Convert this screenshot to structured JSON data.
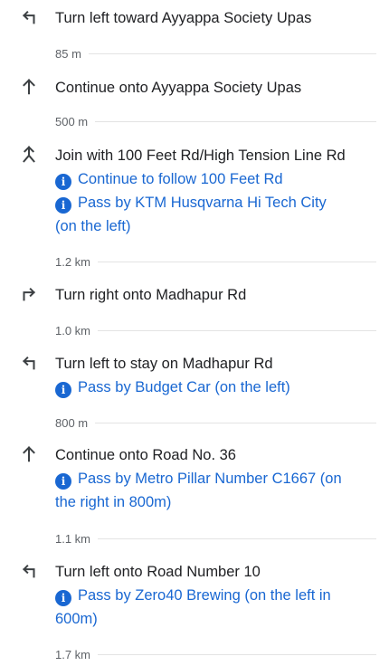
{
  "steps": [
    {
      "icon": "turn-left-icon",
      "instruction": "Turn left toward Ayyappa Society Upas",
      "notes": [],
      "distance": "85 m"
    },
    {
      "icon": "straight-arrow-icon",
      "instruction": "Continue onto Ayyappa Society Upas",
      "notes": [],
      "distance": "500 m"
    },
    {
      "icon": "merge-icon",
      "instruction": "Join with 100 Feet Rd/High Tension Line Rd",
      "notes": [
        {
          "text": "Continue to follow 100 Feet Rd"
        },
        {
          "line1": "Pass by KTM Husqvarna Hi Tech City",
          "line2": "(on the left)"
        }
      ],
      "distance": "1.2 km"
    },
    {
      "icon": "turn-right-icon",
      "instruction": "Turn right onto Madhapur Rd",
      "notes": [],
      "distance": "1.0 km"
    },
    {
      "icon": "turn-left-icon",
      "instruction": "Turn left to stay on Madhapur Rd",
      "notes": [
        {
          "text": "Pass by Budget Car (on the left)"
        }
      ],
      "distance": "800 m"
    },
    {
      "icon": "straight-arrow-icon",
      "instruction": "Continue onto Road No. 36",
      "notes": [
        {
          "line1": "Pass by Metro Pillar Number C1667 (on",
          "line2": "the right in 800m)"
        }
      ],
      "distance": "1.1 km"
    },
    {
      "icon": "turn-left-icon",
      "instruction": "Turn left onto Road Number 10",
      "notes": [
        {
          "line1": "Pass by Zero40 Brewing (on the left in",
          "line2": "600m)"
        }
      ],
      "distance": "1.7 km"
    }
  ],
  "colors": {
    "text": "#202124",
    "link": "#1967d2",
    "muted": "#5f6368",
    "icon": "#3c4043",
    "divider": "#e3e3e3"
  }
}
